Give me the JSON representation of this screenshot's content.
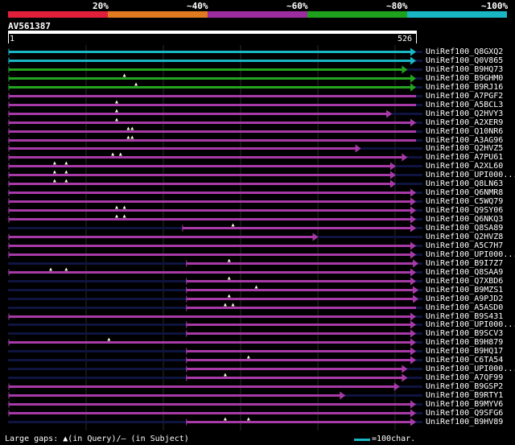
{
  "query": {
    "name": "AV561387",
    "start": "1",
    "end": "526",
    "length": 526
  },
  "scale": {
    "labels": [
      "20%",
      "~40%",
      "~60%",
      "~80%",
      "~100%"
    ],
    "colors": [
      "#e0203a",
      "#e07a20",
      "#9b2d9e",
      "#1ea21e",
      "#19b7c4"
    ]
  },
  "legend": {
    "gaps": "Large gaps: ▲(in Query)/— (in Subject)",
    "scale": "=100char."
  },
  "colors": {
    "cyan": "#19b7c4",
    "green": "#23a31f",
    "magenta": "#a83aa8",
    "navy": "#0f1440",
    "grid": "#2a2a2a"
  },
  "chart_data": {
    "type": "alignment",
    "hits": [
      {
        "name": "UniRef100_Q8GXQ2",
        "color": "cyan",
        "start": 1,
        "end": 526,
        "gaps_query": [],
        "end_marker": true
      },
      {
        "name": "UniRef100_Q0V865",
        "color": "cyan",
        "start": 1,
        "end": 526,
        "gaps_query": [],
        "end_marker": true
      },
      {
        "name": "UniRef100_B9HQ73",
        "color": "green",
        "start": 1,
        "end": 515,
        "gaps_query": [],
        "end_marker": true
      },
      {
        "name": "UniRef100_B9GHM0",
        "color": "green",
        "start": 1,
        "end": 526,
        "gaps_query": [
          150
        ],
        "end_marker": true
      },
      {
        "name": "UniRef100_B9RJ16",
        "color": "green",
        "start": 1,
        "end": 526,
        "gaps_query": [
          165
        ],
        "end_marker": true
      },
      {
        "name": "UniRef100_A7PGF2",
        "color": "magenta",
        "start": 1,
        "end": 526,
        "gaps_query": [],
        "end_marker": false
      },
      {
        "name": "UniRef100_A5BCL3",
        "color": "magenta",
        "start": 1,
        "end": 526,
        "gaps_query": [
          140
        ],
        "end_marker": false
      },
      {
        "name": "UniRef100_Q2HVY3",
        "color": "magenta",
        "start": 1,
        "end": 495,
        "gaps_query": [
          140
        ],
        "end_marker": true
      },
      {
        "name": "UniRef100_A2XER9",
        "color": "magenta",
        "start": 1,
        "end": 526,
        "gaps_query": [
          140
        ],
        "end_marker": true
      },
      {
        "name": "UniRef100_Q10NR6",
        "color": "magenta",
        "start": 1,
        "end": 526,
        "gaps_query": [
          155,
          160
        ],
        "end_marker": false
      },
      {
        "name": "UniRef100_A3AG96",
        "color": "magenta",
        "start": 1,
        "end": 526,
        "gaps_query": [
          155,
          160
        ],
        "end_marker": false
      },
      {
        "name": "UniRef100_Q2HVZ5",
        "color": "magenta",
        "start": 1,
        "end": 455,
        "gaps_query": [],
        "end_marker": true
      },
      {
        "name": "UniRef100_A7PU61",
        "color": "magenta",
        "start": 1,
        "end": 515,
        "gaps_query": [
          135,
          145
        ],
        "end_marker": true
      },
      {
        "name": "UniRef100_A2XL60",
        "color": "magenta",
        "start": 1,
        "end": 500,
        "gaps_query": [
          60,
          75
        ],
        "end_marker": true
      },
      {
        "name": "UniRef100_UPI000...",
        "color": "magenta",
        "start": 1,
        "end": 500,
        "gaps_query": [
          60,
          75
        ],
        "end_marker": true
      },
      {
        "name": "UniRef100_Q8LN63",
        "color": "magenta",
        "start": 1,
        "end": 500,
        "gaps_query": [
          60,
          75
        ],
        "end_marker": true
      },
      {
        "name": "UniRef100_Q6NMR8",
        "color": "magenta",
        "start": 1,
        "end": 526,
        "gaps_query": [],
        "end_marker": true
      },
      {
        "name": "UniRef100_C5WQ79",
        "color": "magenta",
        "start": 1,
        "end": 526,
        "gaps_query": [],
        "end_marker": true
      },
      {
        "name": "UniRef100_Q9SY06",
        "color": "magenta",
        "start": 1,
        "end": 526,
        "gaps_query": [
          140,
          150
        ],
        "end_marker": true
      },
      {
        "name": "UniRef100_Q6NKQ3",
        "color": "magenta",
        "start": 1,
        "end": 526,
        "gaps_query": [
          140,
          150
        ],
        "end_marker": true
      },
      {
        "name": "UniRef100_Q8SA89",
        "color": "magenta",
        "start": 225,
        "end": 526,
        "gaps_query": [
          290
        ],
        "end_marker": true
      },
      {
        "name": "UniRef100_Q2HVZ8",
        "color": "magenta",
        "start": 1,
        "end": 400,
        "gaps_query": [],
        "end_marker": true
      },
      {
        "name": "UniRef100_A5C7H7",
        "color": "magenta",
        "start": 1,
        "end": 526,
        "gaps_query": [],
        "end_marker": true
      },
      {
        "name": "UniRef100_UPI000...",
        "color": "magenta",
        "start": 1,
        "end": 526,
        "gaps_query": [],
        "end_marker": true
      },
      {
        "name": "UniRef100_B9I7Z7",
        "color": "magenta",
        "start": 230,
        "end": 555,
        "gaps_query": [
          285
        ],
        "end_marker": true
      },
      {
        "name": "UniRef100_Q8SAA9",
        "color": "magenta",
        "start": 1,
        "end": 526,
        "gaps_query": [
          55,
          75
        ],
        "end_marker": true
      },
      {
        "name": "UniRef100_Q7XBD6",
        "color": "magenta",
        "start": 230,
        "end": 526,
        "gaps_query": [
          285
        ],
        "end_marker": true
      },
      {
        "name": "UniRef100_B9MZS1",
        "color": "magenta",
        "start": 230,
        "end": 555,
        "gaps_query": [
          320
        ],
        "end_marker": true
      },
      {
        "name": "UniRef100_A9PJD2",
        "color": "magenta",
        "start": 230,
        "end": 555,
        "gaps_query": [
          285
        ],
        "end_marker": true
      },
      {
        "name": "UniRef100_A5ASD0",
        "color": "magenta",
        "start": 230,
        "end": 526,
        "gaps_query": [
          280,
          290
        ],
        "end_marker": false
      },
      {
        "name": "UniRef100_B9S431",
        "color": "magenta",
        "start": 1,
        "end": 526,
        "gaps_query": [],
        "end_marker": true
      },
      {
        "name": "UniRef100_UPI000...",
        "color": "magenta",
        "start": 230,
        "end": 526,
        "gaps_query": [],
        "end_marker": true
      },
      {
        "name": "UniRef100_B9SCV3",
        "color": "magenta",
        "start": 230,
        "end": 526,
        "gaps_query": [],
        "end_marker": true
      },
      {
        "name": "UniRef100_B9H879",
        "color": "magenta",
        "start": 1,
        "end": 526,
        "gaps_query": [
          130
        ],
        "end_marker": true
      },
      {
        "name": "UniRef100_B9HQ17",
        "color": "magenta",
        "start": 230,
        "end": 526,
        "gaps_query": [],
        "end_marker": true
      },
      {
        "name": "UniRef100_C6TA54",
        "color": "magenta",
        "start": 230,
        "end": 526,
        "gaps_query": [
          310
        ],
        "end_marker": true
      },
      {
        "name": "UniRef100_UPI000...",
        "color": "magenta",
        "start": 230,
        "end": 515,
        "gaps_query": [],
        "end_marker": true
      },
      {
        "name": "UniRef100_A7QF99",
        "color": "magenta",
        "start": 230,
        "end": 515,
        "gaps_query": [
          280
        ],
        "end_marker": true
      },
      {
        "name": "UniRef100_B9GSP2",
        "color": "magenta",
        "start": 1,
        "end": 505,
        "gaps_query": [],
        "end_marker": true
      },
      {
        "name": "UniRef100_B9RTY1",
        "color": "magenta",
        "start": 1,
        "end": 435,
        "gaps_query": [],
        "end_marker": true
      },
      {
        "name": "UniRef100_B9MYV6",
        "color": "magenta",
        "start": 1,
        "end": 526,
        "gaps_query": [],
        "end_marker": true
      },
      {
        "name": "UniRef100_Q9SFG6",
        "color": "magenta",
        "start": 1,
        "end": 526,
        "gaps_query": [],
        "end_marker": true
      },
      {
        "name": "UniRef100_B9HV89",
        "color": "magenta",
        "start": 230,
        "end": 526,
        "gaps_query": [
          280,
          310
        ],
        "end_marker": true
      }
    ]
  }
}
